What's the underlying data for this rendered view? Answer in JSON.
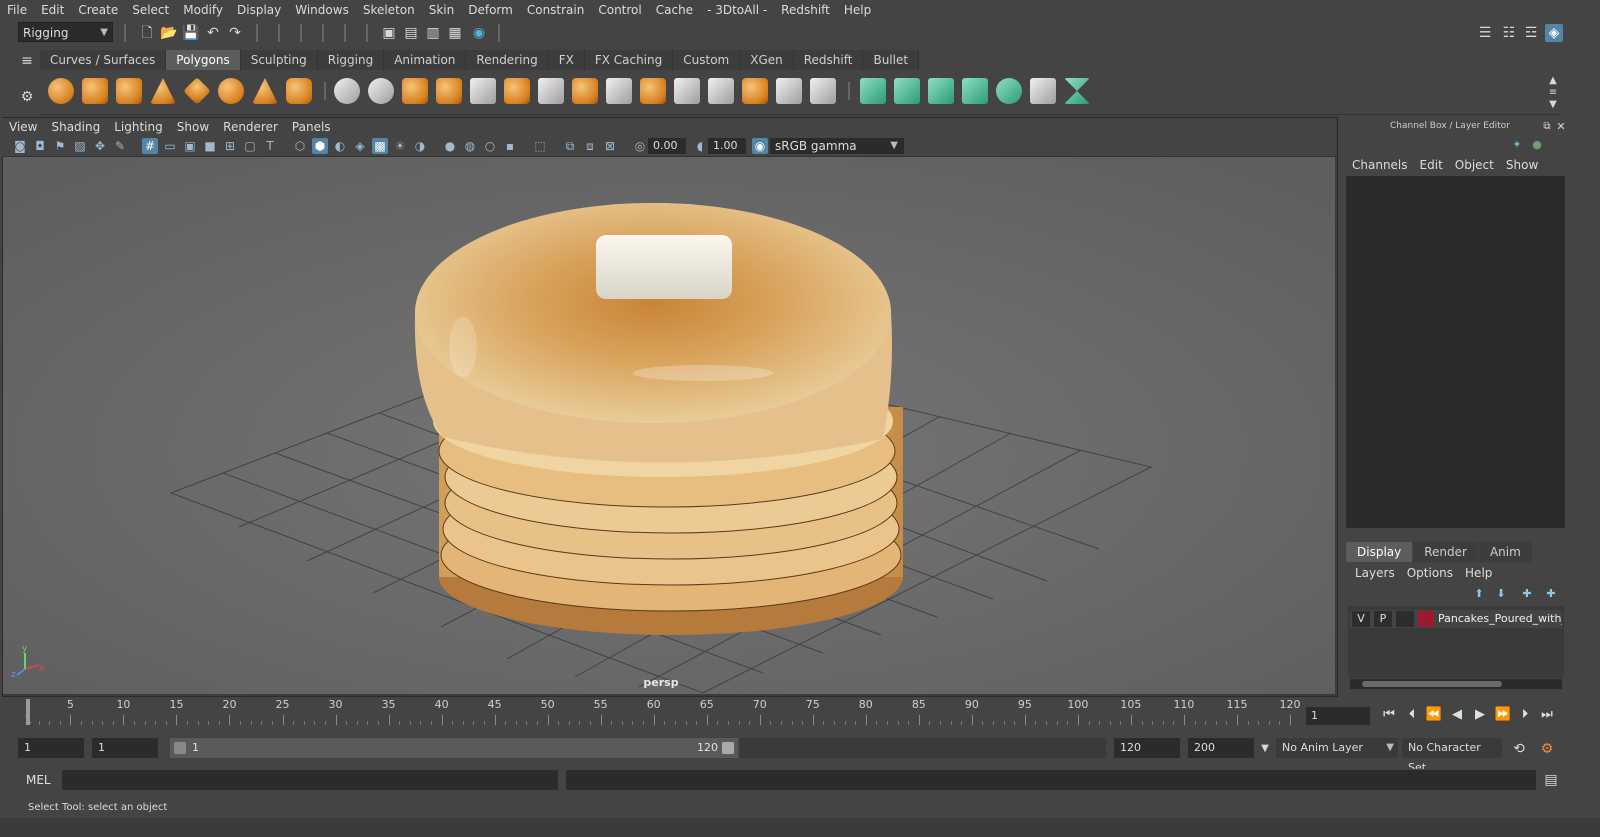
{
  "menubar": {
    "items": [
      "File",
      "Edit",
      "Create",
      "Select",
      "Modify",
      "Display",
      "Windows",
      "Skeleton",
      "Skin",
      "Deform",
      "Constrain",
      "Control",
      "Cache",
      "- 3DtoAll -",
      "Redshift",
      "Help"
    ]
  },
  "statusline": {
    "menuset": "Rigging"
  },
  "shelf": {
    "tabs": [
      "Curves / Surfaces",
      "Polygons",
      "Sculpting",
      "Rigging",
      "Animation",
      "Rendering",
      "FX",
      "FX Caching",
      "Custom",
      "XGen",
      "Redshift",
      "Bullet"
    ],
    "active_tab": "Polygons"
  },
  "viewport": {
    "menu": [
      "View",
      "Shading",
      "Lighting",
      "Show",
      "Renderer",
      "Panels"
    ],
    "exposure": "0.00",
    "gamma": "1.00",
    "color_space": "sRGB gamma",
    "camera_label": "persp",
    "axis": {
      "x": "x",
      "y": "y",
      "z": "z"
    }
  },
  "channel_box": {
    "title": "Channel Box / Layer Editor",
    "menu": [
      "Channels",
      "Edit",
      "Object",
      "Show"
    ]
  },
  "layer_editor": {
    "tabs": [
      "Display",
      "Render",
      "Anim"
    ],
    "active_tab": "Display",
    "menu": [
      "Layers",
      "Options",
      "Help"
    ],
    "layers": [
      {
        "v": "V",
        "p": "P",
        "color": "#9b1a2e",
        "name": "Pancakes_Poured_with_I"
      }
    ]
  },
  "timeline": {
    "labels": [
      "5",
      "10",
      "15",
      "20",
      "25",
      "30",
      "35",
      "40",
      "45",
      "50",
      "55",
      "60",
      "65",
      "70",
      "75",
      "80",
      "85",
      "90",
      "95",
      "100",
      "105",
      "110",
      "115",
      "120"
    ],
    "start_marker": "1",
    "current_frame": "1"
  },
  "range": {
    "start": "1",
    "playback_start": "1",
    "slider_start": "1",
    "slider_end": "120",
    "playback_end": "120",
    "end": "200",
    "anim_layer": "No Anim Layer",
    "character_set": "No Character Set"
  },
  "command_line": {
    "language": "MEL"
  },
  "help_line": {
    "text": "Select Tool: select an object"
  },
  "colors": {
    "accent": "#5285a6",
    "shelf_green": "#3fb38c",
    "shelf_orange": "#e0902a"
  }
}
